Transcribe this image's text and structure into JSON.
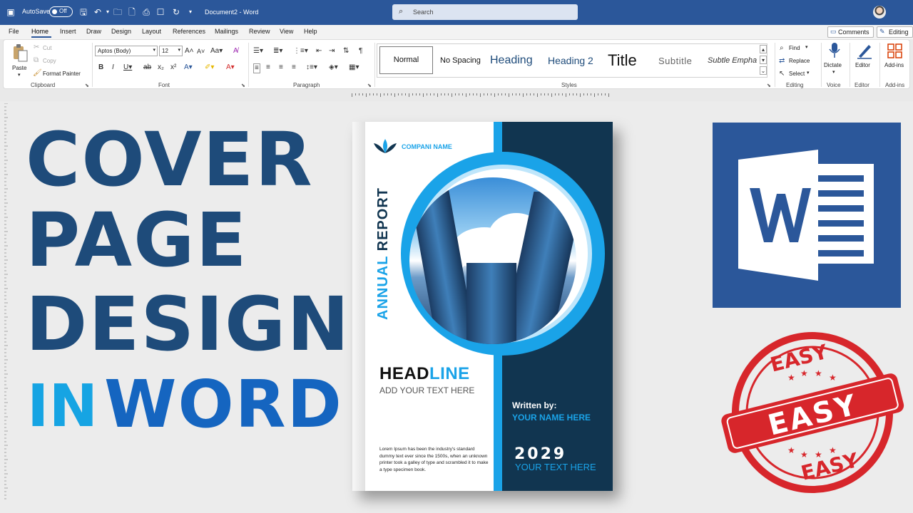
{
  "titlebar": {
    "autosave_label": "AutoSave",
    "autosave_state": "Off",
    "doc_title": "Document2  -  Word",
    "search_placeholder": "Search"
  },
  "menu": {
    "items": [
      "File",
      "Home",
      "Insert",
      "Draw",
      "Design",
      "Layout",
      "References",
      "Mailings",
      "Review",
      "View",
      "Help"
    ],
    "active": "Home",
    "comments_label": "Comments",
    "editing_label": "Editing"
  },
  "ribbon": {
    "clipboard": {
      "paste": "Paste",
      "cut": "Cut",
      "copy": "Copy",
      "format_painter": "Format Painter",
      "label": "Clipboard"
    },
    "font": {
      "family": "Aptos (Body)",
      "size": "12",
      "label": "Font"
    },
    "paragraph": {
      "label": "Paragraph"
    },
    "styles": {
      "items": [
        "Normal",
        "No Spacing",
        "Heading",
        "Heading 2",
        "Title",
        "Subtitle",
        "Subtle Empha"
      ],
      "label": "Styles"
    },
    "editing": {
      "find": "Find",
      "replace": "Replace",
      "select": "Select",
      "label": "Editing"
    },
    "voice": {
      "dictate": "Dictate",
      "label": "Voice"
    },
    "editor": {
      "editor": "Editor",
      "label": "Editor"
    },
    "addins": {
      "addins": "Add-ins",
      "label": "Add-ins"
    }
  },
  "hero": {
    "line1": "COVER",
    "line2": "PAGE",
    "line3": "DESIGN",
    "line4a": "IN",
    "line4b": "WORD"
  },
  "cover": {
    "company": "COMPANI NAME",
    "annual_a": "ANNUAL",
    "annual_b": "REPORT",
    "headline_a": "HEAD",
    "headline_b": "LINE",
    "add_text": "ADD YOUR TEXT HERE",
    "lorem": "Lorem Ipsum has been the industry's standard dummy text ever since the 1500s, when an unknown printer took a galley of type and scrambled it to make a type specimen book.",
    "written_by": "Written by:",
    "your_name": "YOUR NAME HERE",
    "year": "2029",
    "your_text": "YOUR TEXT HERE"
  },
  "stamp": {
    "top": "EASY",
    "center": "EASY",
    "bottom": "EASY"
  },
  "colors": {
    "word_blue": "#2b579a",
    "hero_navy": "#1e4b7a",
    "hero_cyan": "#16a4e3",
    "stamp_red": "#d7262b"
  }
}
